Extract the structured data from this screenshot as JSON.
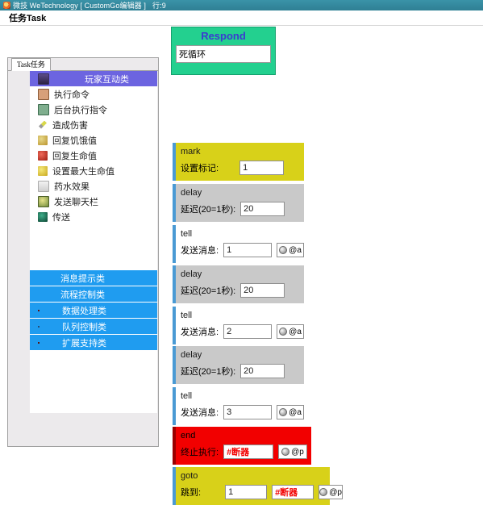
{
  "window": {
    "title": "微技 WeTechnology [ CustomGo编辑器 ]",
    "row_indicator": "行:9",
    "app_icon": "app-icon"
  },
  "menubar": {
    "items": [
      {
        "label": "任务Task"
      }
    ]
  },
  "left_panel": {
    "tab": {
      "label": "Task任务"
    },
    "tree_items": [
      {
        "label": "玩家互动类",
        "icon": "potion-icon",
        "selected": true
      },
      {
        "label": "执行命令",
        "icon": "command-block-icon",
        "selected": false
      },
      {
        "label": "后台执行指令",
        "icon": "chain-command-block-icon",
        "selected": false
      },
      {
        "label": "造成伤害",
        "icon": "sword-icon",
        "selected": false
      },
      {
        "label": "回复饥饿值",
        "icon": "golden-apple-icon",
        "selected": false
      },
      {
        "label": "回复生命值",
        "icon": "apple-icon",
        "selected": false
      },
      {
        "label": "设置最大生命值",
        "icon": "yellow-apple-icon",
        "selected": false
      },
      {
        "label": "药水效果",
        "icon": "bottle-icon",
        "selected": false
      },
      {
        "label": "发送聊天栏",
        "icon": "player-head-icon",
        "selected": false
      },
      {
        "label": "传送",
        "icon": "ender-pearl-icon",
        "selected": false
      }
    ],
    "categories": [
      {
        "label": "消息提示类",
        "icon": "message-icon"
      },
      {
        "label": "流程控制类",
        "icon": "flow-icon"
      },
      {
        "label": "数据处理类",
        "icon": "data-icon"
      },
      {
        "label": "队列控制类",
        "icon": "queue-icon"
      },
      {
        "label": "扩展支持类",
        "icon": "extension-icon"
      }
    ]
  },
  "respond": {
    "title": "Respond",
    "value": "死循环",
    "placeholder": ""
  },
  "blocks": [
    {
      "keyword": "mark",
      "color": "#d8d119",
      "label": "设置标记:",
      "value": "1",
      "target": null,
      "extra": null
    },
    {
      "keyword": "delay",
      "color": "#c9c9c9",
      "label": "延迟(20=1秒):",
      "value": "20",
      "target": null,
      "extra": null
    },
    {
      "keyword": "tell",
      "color": "#ffffff",
      "label": "发送消息:",
      "value": "1",
      "target": "@a",
      "extra": null
    },
    {
      "keyword": "delay",
      "color": "#c9c9c9",
      "label": "延迟(20=1秒):",
      "value": "20",
      "target": null,
      "extra": null
    },
    {
      "keyword": "tell",
      "color": "#ffffff",
      "label": "发送消息:",
      "value": "2",
      "target": "@a",
      "extra": null
    },
    {
      "keyword": "delay",
      "color": "#c9c9c9",
      "label": "延迟(20=1秒):",
      "value": "20",
      "target": null,
      "extra": null
    },
    {
      "keyword": "tell",
      "color": "#ffffff",
      "label": "发送消息:",
      "value": "3",
      "target": "@a",
      "extra": null
    },
    {
      "keyword": "end",
      "color": "#f20000",
      "label": "终止执行:",
      "value": "#断器",
      "target": "@p",
      "extra": null
    },
    {
      "keyword": "goto",
      "color": "#d8d119",
      "label": "跳到:",
      "value": "1",
      "target": "@p",
      "extra": "#断器"
    }
  ]
}
